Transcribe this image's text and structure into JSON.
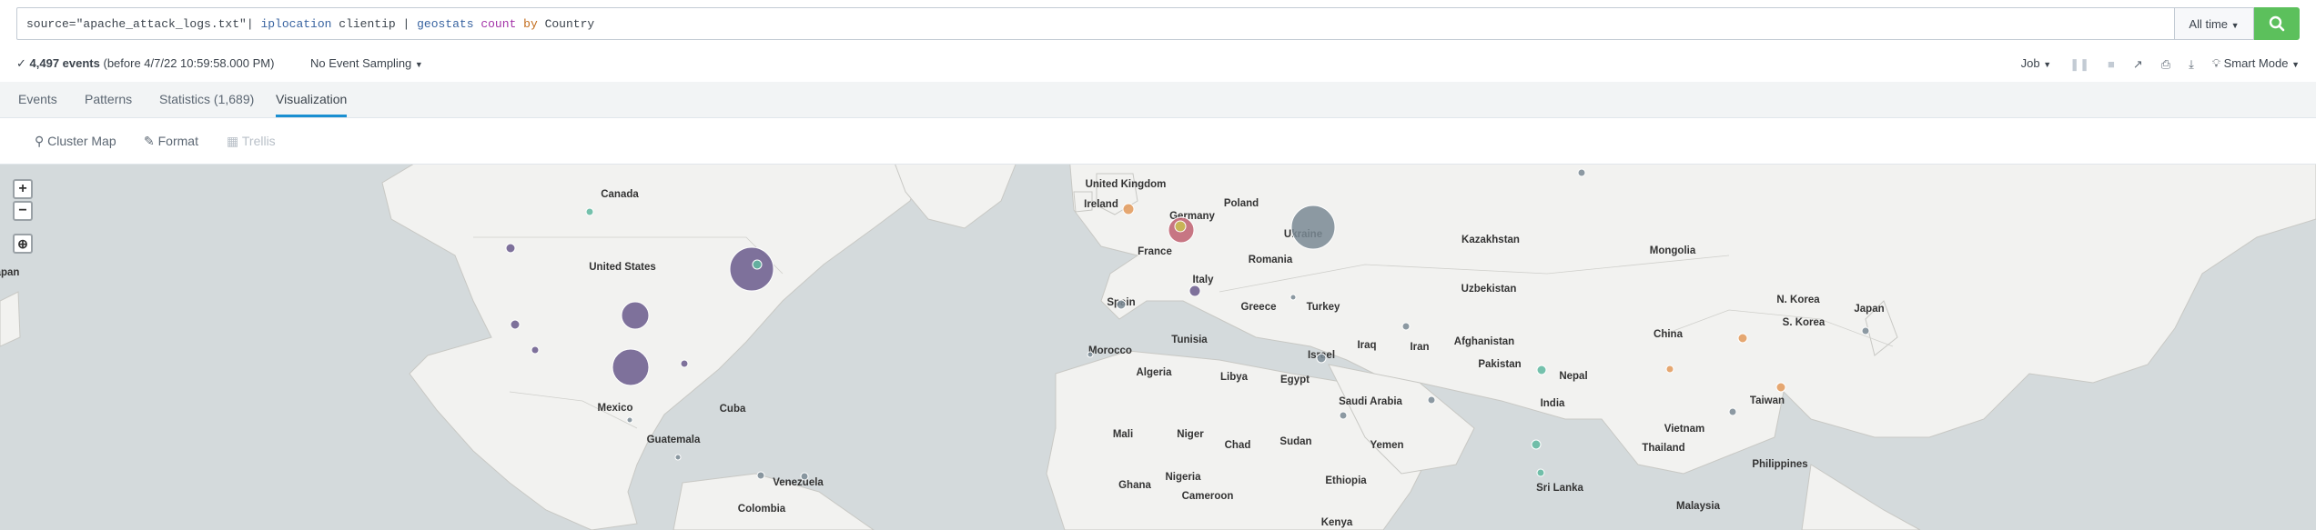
{
  "search": {
    "query_parts": [
      {
        "text": "source=\"apache_attack_logs.txt\"| ",
        "kind": "str"
      },
      {
        "text": "iplocation",
        "kind": "cmd"
      },
      {
        "text": " clientip | ",
        "kind": "str"
      },
      {
        "text": "geostats",
        "kind": "cmd"
      },
      {
        "text": " ",
        "kind": "str"
      },
      {
        "text": "count",
        "kind": "fn"
      },
      {
        "text": " ",
        "kind": "str"
      },
      {
        "text": "by",
        "kind": "kw"
      },
      {
        "text": " Country",
        "kind": "str"
      }
    ],
    "time_range": "All time",
    "search_icon": "search-icon"
  },
  "status": {
    "check": "✓",
    "events_count": "4,497 events",
    "events_suffix": "(before 4/7/22 10:59:58.000 PM)",
    "sampling": "No Event Sampling",
    "job_label": "Job",
    "mode": "Smart Mode"
  },
  "tabs": [
    {
      "label": "Events"
    },
    {
      "label": "Patterns"
    },
    {
      "label": "Statistics (1,689)"
    },
    {
      "label": "Visualization"
    }
  ],
  "viz_toolbar": {
    "type_label": "Cluster Map",
    "format_label": "Format",
    "trellis_label": "Trellis"
  },
  "map": {
    "zoom_in": "+",
    "zoom_out": "−",
    "labels": [
      "Canada",
      "United States",
      "Mexico",
      "Cuba",
      "Guatemala",
      "Venezuela",
      "Colombia",
      "apan",
      "United Kingdom",
      "Ireland",
      "Germany",
      "Poland",
      "Ukraine",
      "France",
      "Romania",
      "Italy",
      "Spain",
      "Greece",
      "Turkey",
      "Morocco",
      "Tunisia",
      "Algeria",
      "Libya",
      "Egypt",
      "Israel",
      "Iraq",
      "Iran",
      "Saudi Arabia",
      "Yemen",
      "Mali",
      "Niger",
      "Chad",
      "Sudan",
      "Nigeria",
      "Ethiopia",
      "Ghana",
      "Cameroon",
      "Kenya",
      "Kazakhstan",
      "Uzbekistan",
      "Afghanistan",
      "Pakistan",
      "Nepal",
      "India",
      "Sri Lanka",
      "Mongolia",
      "China",
      "N. Korea",
      "S. Korea",
      "Japan",
      "Taiwan",
      "Vietnam",
      "Thailand",
      "Philippines",
      "Malaysia"
    ]
  },
  "colors": {
    "accent": "#1a8fd1",
    "search_button": "#5cc05c",
    "map_water": "#d4dadc",
    "map_land": "#f2f2f0",
    "marker_purple": "#6a5a8c",
    "marker_teal": "#5fb8a0",
    "marker_orange": "#e39a5b",
    "marker_gray": "#7a8a94"
  }
}
